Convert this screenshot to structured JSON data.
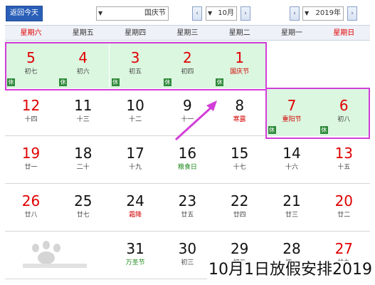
{
  "toolbar": {
    "back_today_label": "返回今天",
    "holiday_select_value": "国庆节",
    "month_select_value": "10月",
    "year_select_value": "2019年",
    "prev_arrow": "‹",
    "next_arrow": "›"
  },
  "weekdays": [
    "星期六",
    "星期五",
    "星期四",
    "星期三",
    "星期二",
    "星期一",
    "星期日"
  ],
  "weeks": [
    [
      {
        "day": "5",
        "lunar": "初七",
        "holiday": true
      },
      {
        "day": "4",
        "lunar": "初六",
        "holiday": true
      },
      {
        "day": "3",
        "lunar": "初五",
        "holiday": true
      },
      {
        "day": "2",
        "lunar": "初四",
        "holiday": true
      },
      {
        "day": "1",
        "lunar": "国庆节",
        "holiday": true
      },
      null,
      null
    ],
    [
      {
        "day": "12",
        "lunar": "十四"
      },
      {
        "day": "11",
        "lunar": "十三"
      },
      {
        "day": "10",
        "lunar": "十二"
      },
      {
        "day": "9",
        "lunar": "十一"
      },
      {
        "day": "8",
        "lunar": "寒露"
      },
      {
        "day": "7",
        "lunar": "重阳节",
        "holiday": true
      },
      {
        "day": "6",
        "lunar": "初八",
        "holiday": true
      }
    ],
    [
      {
        "day": "19",
        "lunar": "廿一"
      },
      {
        "day": "18",
        "lunar": "二十"
      },
      {
        "day": "17",
        "lunar": "十九"
      },
      {
        "day": "16",
        "lunar": "粮食日"
      },
      {
        "day": "15",
        "lunar": "十七"
      },
      {
        "day": "14",
        "lunar": "十六"
      },
      {
        "day": "13",
        "lunar": "十五"
      }
    ],
    [
      {
        "day": "26",
        "lunar": "廿八"
      },
      {
        "day": "25",
        "lunar": "廿七"
      },
      {
        "day": "24",
        "lunar": "霜降"
      },
      {
        "day": "23",
        "lunar": "廿五"
      },
      {
        "day": "22",
        "lunar": "廿四"
      },
      {
        "day": "21",
        "lunar": "廿三"
      },
      {
        "day": "20",
        "lunar": "廿二"
      }
    ],
    [
      null,
      null,
      {
        "day": "31",
        "lunar": "万圣节"
      },
      {
        "day": "30",
        "lunar": "初三"
      },
      {
        "day": "29",
        "lunar": "初二"
      },
      {
        "day": "28",
        "lunar": "初一"
      },
      {
        "day": "27",
        "lunar": "廿九"
      }
    ]
  ],
  "holiday_badge": "休",
  "caption": "10月1日放假安排2019",
  "colors": {
    "highlight_bg": "#dbf7e0",
    "frame": "#d23ed8",
    "weekend_red": "#e00000",
    "badge_green": "#2f8a3a"
  }
}
